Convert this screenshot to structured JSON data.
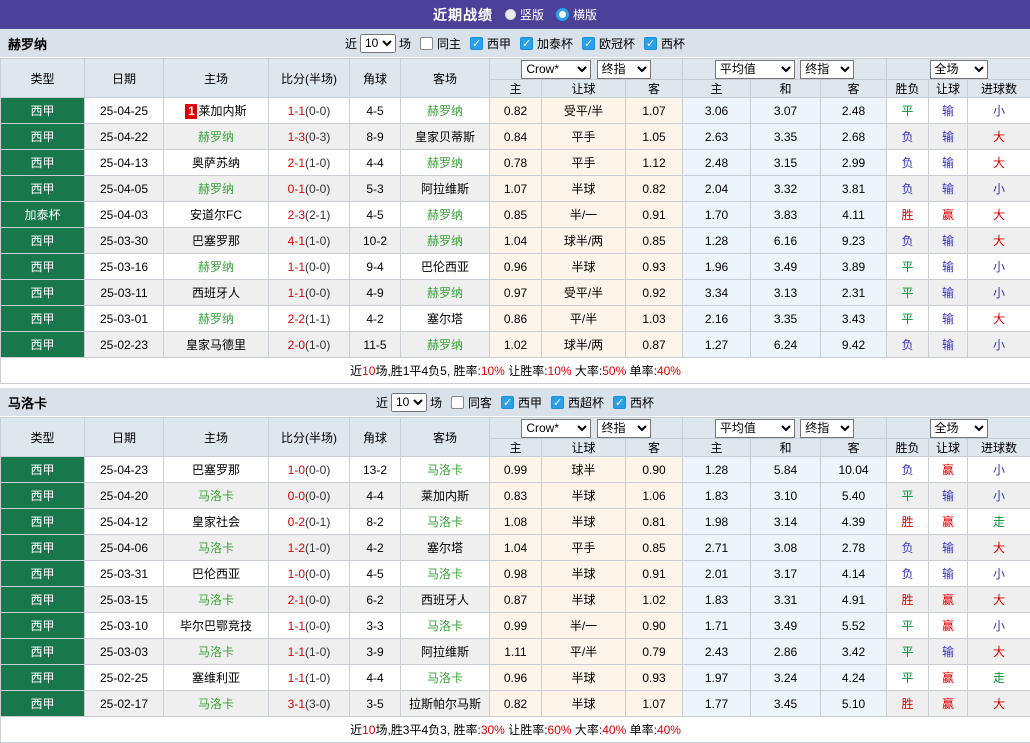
{
  "page": {
    "title": "近期战绩",
    "vertical_label": "竖版",
    "horizontal_label": "横版",
    "selected_layout": "横版"
  },
  "colors": {
    "accent_purple": "#4c4199",
    "type_green": "#18784b",
    "focal_team_green": "#3aa23a",
    "score_red": "#df0000",
    "win_red": "#df0000",
    "lose_blue": "#3431c6",
    "draw_green": "#009430",
    "asia_col_bg": "#fdf5ea",
    "euro_col_bg": "#ecf5f9"
  },
  "table_headers": {
    "type": "类型",
    "date": "日期",
    "home": "主场",
    "score": "比分(半场)",
    "corner": "角球",
    "away": "客场",
    "asia_home": "主",
    "asia_handicap": "让球",
    "asia_away": "客",
    "euro_home": "主",
    "euro_draw": "和",
    "euro_away": "客",
    "result": "胜负",
    "result_handicap": "让球",
    "result_goals": "进球数"
  },
  "teams": [
    {
      "name": "赫罗纳",
      "filter": {
        "near": "近",
        "count": "10",
        "games": "场",
        "same": "同主",
        "leagues": [
          "西甲",
          "加泰杯",
          "欧冠杯",
          "西杯"
        ]
      },
      "selects": {
        "company": "Crow*",
        "stage1": "终指",
        "avg": "平均值",
        "stage2": "终指",
        "scope": "全场"
      },
      "rows": [
        {
          "type": "西甲",
          "date": "25-04-25",
          "home": "莱加内斯",
          "home_badge": "1",
          "score": "1-1",
          "half": "(0-0)",
          "corner": "4-5",
          "away": "赫罗纳",
          "h1": "0.82",
          "handicap": "受平/半",
          "h2": "1.07",
          "e1": "3.06",
          "e2": "3.07",
          "e3": "2.48",
          "r1": "平",
          "r2": "输",
          "r3": "小"
        },
        {
          "type": "西甲",
          "date": "25-04-22",
          "home": "赫罗纳",
          "score": "1-3",
          "half": "(0-3)",
          "corner": "8-9",
          "away": "皇家贝蒂斯",
          "h1": "0.84",
          "handicap": "平手",
          "h2": "1.05",
          "e1": "2.63",
          "e2": "3.35",
          "e3": "2.68",
          "r1": "负",
          "r2": "输",
          "r3": "大"
        },
        {
          "type": "西甲",
          "date": "25-04-13",
          "home": "奥萨苏纳",
          "score": "2-1",
          "half": "(1-0)",
          "corner": "4-4",
          "away": "赫罗纳",
          "h1": "0.78",
          "handicap": "平手",
          "h2": "1.12",
          "e1": "2.48",
          "e2": "3.15",
          "e3": "2.99",
          "r1": "负",
          "r2": "输",
          "r3": "大"
        },
        {
          "type": "西甲",
          "date": "25-04-05",
          "home": "赫罗纳",
          "score": "0-1",
          "half": "(0-0)",
          "corner": "5-3",
          "away": "阿拉维斯",
          "h1": "1.07",
          "handicap": "半球",
          "h2": "0.82",
          "e1": "2.04",
          "e2": "3.32",
          "e3": "3.81",
          "r1": "负",
          "r2": "输",
          "r3": "小"
        },
        {
          "type": "加泰杯",
          "date": "25-04-03",
          "home": "安道尔FC",
          "score": "2-3",
          "half": "(2-1)",
          "corner": "4-5",
          "away": "赫罗纳",
          "h1": "0.85",
          "handicap": "半/一",
          "h2": "0.91",
          "e1": "1.70",
          "e2": "3.83",
          "e3": "4.11",
          "r1": "胜",
          "r2": "赢",
          "r3": "大"
        },
        {
          "type": "西甲",
          "date": "25-03-30",
          "home": "巴塞罗那",
          "score": "4-1",
          "half": "(1-0)",
          "corner": "10-2",
          "away": "赫罗纳",
          "h1": "1.04",
          "handicap": "球半/两",
          "h2": "0.85",
          "e1": "1.28",
          "e2": "6.16",
          "e3": "9.23",
          "r1": "负",
          "r2": "输",
          "r3": "大"
        },
        {
          "type": "西甲",
          "date": "25-03-16",
          "home": "赫罗纳",
          "score": "1-1",
          "half": "(0-0)",
          "corner": "9-4",
          "away": "巴伦西亚",
          "h1": "0.96",
          "handicap": "半球",
          "h2": "0.93",
          "e1": "1.96",
          "e2": "3.49",
          "e3": "3.89",
          "r1": "平",
          "r2": "输",
          "r3": "小"
        },
        {
          "type": "西甲",
          "date": "25-03-11",
          "home": "西班牙人",
          "score": "1-1",
          "half": "(0-0)",
          "corner": "4-9",
          "away": "赫罗纳",
          "h1": "0.97",
          "handicap": "受平/半",
          "h2": "0.92",
          "e1": "3.34",
          "e2": "3.13",
          "e3": "2.31",
          "r1": "平",
          "r2": "输",
          "r3": "小"
        },
        {
          "type": "西甲",
          "date": "25-03-01",
          "home": "赫罗纳",
          "score": "2-2",
          "half": "(1-1)",
          "corner": "4-2",
          "away": "塞尔塔",
          "h1": "0.86",
          "handicap": "平/半",
          "h2": "1.03",
          "e1": "2.16",
          "e2": "3.35",
          "e3": "3.43",
          "r1": "平",
          "r2": "输",
          "r3": "大"
        },
        {
          "type": "西甲",
          "date": "25-02-23",
          "home": "皇家马德里",
          "score": "2-0",
          "half": "(1-0)",
          "corner": "11-5",
          "away": "赫罗纳",
          "h1": "1.02",
          "handicap": "球半/两",
          "h2": "0.87",
          "e1": "1.27",
          "e2": "6.24",
          "e3": "9.42",
          "r1": "负",
          "r2": "输",
          "r3": "小"
        }
      ],
      "summary": {
        "lead": "近",
        "count": "10",
        "mid": "场,胜1平4负5, 胜率:",
        "win_rate": "10%",
        "lbl_let": " 让胜率:",
        "let_rate": "10%",
        "lbl_big": " 大率:",
        "big_rate": "50%",
        "lbl_single": " 单率:",
        "single_rate": "40%"
      }
    },
    {
      "name": "马洛卡",
      "filter": {
        "near": "近",
        "count": "10",
        "games": "场",
        "same": "同客",
        "leagues": [
          "西甲",
          "西超杯",
          "西杯"
        ]
      },
      "selects": {
        "company": "Crow*",
        "stage1": "终指",
        "avg": "平均值",
        "stage2": "终指",
        "scope": "全场"
      },
      "rows": [
        {
          "type": "西甲",
          "date": "25-04-23",
          "home": "巴塞罗那",
          "score": "1-0",
          "half": "(0-0)",
          "corner": "13-2",
          "away": "马洛卡",
          "h1": "0.99",
          "handicap": "球半",
          "h2": "0.90",
          "e1": "1.28",
          "e2": "5.84",
          "e3": "10.04",
          "r1": "负",
          "r2": "赢",
          "r3": "小"
        },
        {
          "type": "西甲",
          "date": "25-04-20",
          "home": "马洛卡",
          "score": "0-0",
          "half": "(0-0)",
          "corner": "4-4",
          "away": "莱加内斯",
          "h1": "0.83",
          "handicap": "半球",
          "h2": "1.06",
          "e1": "1.83",
          "e2": "3.10",
          "e3": "5.40",
          "r1": "平",
          "r2": "输",
          "r3": "小"
        },
        {
          "type": "西甲",
          "date": "25-04-12",
          "home": "皇家社会",
          "score": "0-2",
          "half": "(0-1)",
          "corner": "8-2",
          "away": "马洛卡",
          "h1": "1.08",
          "handicap": "半球",
          "h2": "0.81",
          "e1": "1.98",
          "e2": "3.14",
          "e3": "4.39",
          "r1": "胜",
          "r2": "赢",
          "r3": "走"
        },
        {
          "type": "西甲",
          "date": "25-04-06",
          "home": "马洛卡",
          "score": "1-2",
          "half": "(1-0)",
          "corner": "4-2",
          "away": "塞尔塔",
          "h1": "1.04",
          "handicap": "平手",
          "h2": "0.85",
          "e1": "2.71",
          "e2": "3.08",
          "e3": "2.78",
          "r1": "负",
          "r2": "输",
          "r3": "大"
        },
        {
          "type": "西甲",
          "date": "25-03-31",
          "home": "巴伦西亚",
          "score": "1-0",
          "half": "(0-0)",
          "corner": "4-5",
          "away": "马洛卡",
          "h1": "0.98",
          "handicap": "半球",
          "h2": "0.91",
          "e1": "2.01",
          "e2": "3.17",
          "e3": "4.14",
          "r1": "负",
          "r2": "输",
          "r3": "小"
        },
        {
          "type": "西甲",
          "date": "25-03-15",
          "home": "马洛卡",
          "score": "2-1",
          "half": "(0-0)",
          "corner": "6-2",
          "away": "西班牙人",
          "h1": "0.87",
          "handicap": "半球",
          "h2": "1.02",
          "e1": "1.83",
          "e2": "3.31",
          "e3": "4.91",
          "r1": "胜",
          "r2": "赢",
          "r3": "大"
        },
        {
          "type": "西甲",
          "date": "25-03-10",
          "home": "毕尔巴鄂竞技",
          "score": "1-1",
          "half": "(0-0)",
          "corner": "3-3",
          "away": "马洛卡",
          "h1": "0.99",
          "handicap": "半/一",
          "h2": "0.90",
          "e1": "1.71",
          "e2": "3.49",
          "e3": "5.52",
          "r1": "平",
          "r2": "赢",
          "r3": "小"
        },
        {
          "type": "西甲",
          "date": "25-03-03",
          "home": "马洛卡",
          "score": "1-1",
          "half": "(1-0)",
          "corner": "3-9",
          "away": "阿拉维斯",
          "h1": "1.11",
          "handicap": "平/半",
          "h2": "0.79",
          "e1": "2.43",
          "e2": "2.86",
          "e3": "3.42",
          "r1": "平",
          "r2": "输",
          "r3": "大"
        },
        {
          "type": "西甲",
          "date": "25-02-25",
          "home": "塞维利亚",
          "score": "1-1",
          "half": "(1-0)",
          "corner": "4-4",
          "away": "马洛卡",
          "h1": "0.96",
          "handicap": "半球",
          "h2": "0.93",
          "e1": "1.97",
          "e2": "3.24",
          "e3": "4.24",
          "r1": "平",
          "r2": "赢",
          "r3": "走"
        },
        {
          "type": "西甲",
          "date": "25-02-17",
          "home": "马洛卡",
          "score": "3-1",
          "half": "(3-0)",
          "corner": "3-5",
          "away": "拉斯帕尔马斯",
          "h1": "0.82",
          "handicap": "半球",
          "h2": "1.07",
          "e1": "1.77",
          "e2": "3.45",
          "e3": "5.10",
          "r1": "胜",
          "r2": "赢",
          "r3": "大"
        }
      ],
      "summary": {
        "lead": "近",
        "count": "10",
        "mid": "场,胜3平4负3, 胜率:",
        "win_rate": "30%",
        "lbl_let": " 让胜率:",
        "let_rate": "60%",
        "lbl_big": " 大率:",
        "big_rate": "40%",
        "lbl_single": " 单率:",
        "single_rate": "40%"
      }
    }
  ]
}
